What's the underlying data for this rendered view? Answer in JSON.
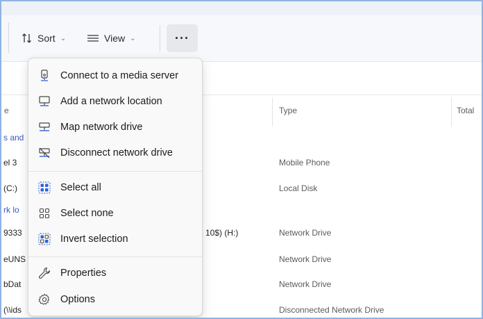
{
  "toolbar": {
    "sort_label": "Sort",
    "view_label": "View",
    "more_label": "···"
  },
  "columns": {
    "name_partial": "e",
    "type": "Type",
    "total_partial": "Total"
  },
  "rows": [
    {
      "name": "s and",
      "type": "",
      "is_group": true
    },
    {
      "name": "el 3",
      "type": "Mobile Phone",
      "is_group": false
    },
    {
      "name": "(C:)",
      "type": "Local Disk",
      "is_group": false
    },
    {
      "name": "rk lo",
      "type": "",
      "is_group": true
    },
    {
      "name": "9333",
      "extra": "10$) (H:)",
      "type": "Network Drive",
      "is_group": false
    },
    {
      "name": "eUNS",
      "type": "Network Drive",
      "is_group": false
    },
    {
      "name": "bDat",
      "type": "Network Drive",
      "is_group": false
    },
    {
      "name": "(\\\\ids",
      "type": "Disconnected Network Drive",
      "is_group": false
    }
  ],
  "menu": {
    "items": [
      {
        "label": "Connect to a media server",
        "icon": "media-server-icon"
      },
      {
        "label": "Add a network location",
        "icon": "network-location-icon"
      },
      {
        "label": "Map network drive",
        "icon": "map-network-drive-icon"
      },
      {
        "label": "Disconnect network drive",
        "icon": "disconnect-network-drive-icon"
      },
      {
        "label": "Select all",
        "icon": "select-all-icon"
      },
      {
        "label": "Select none",
        "icon": "select-none-icon"
      },
      {
        "label": "Invert selection",
        "icon": "invert-selection-icon"
      },
      {
        "label": "Properties",
        "icon": "wrench-icon"
      },
      {
        "label": "Options",
        "icon": "gear-icon"
      }
    ]
  },
  "colors": {
    "accent": "#2b63d9",
    "link": "#3a56c6",
    "frame_border": "#8fb3e3"
  }
}
